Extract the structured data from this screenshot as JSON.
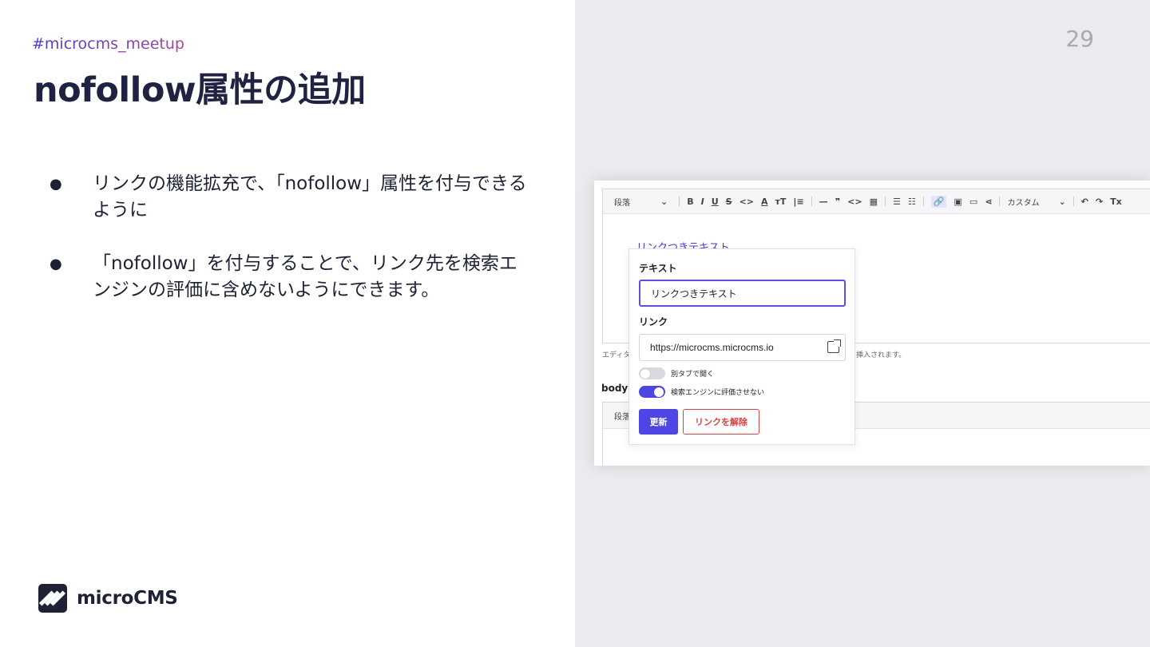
{
  "slide": {
    "hashtag": "#microcms_meetup",
    "title": "nofollow属性の追加",
    "page_number": "29",
    "bullets": [
      {
        "marker": "●",
        "text": "リンクの機能拡充で、「nofollow」属性を付与できるように"
      },
      {
        "marker": "●",
        "text": "「nofollow」を付与することで、リンク先を検索エンジンの評価に含めないようにできます。"
      }
    ],
    "logo_text": "microCMS"
  },
  "screenshot": {
    "toolbar": {
      "paragraph_select": "段落",
      "chevron": "⌄",
      "buttons": [
        "B",
        "I",
        "U",
        "S",
        "<>",
        "A",
        "ᴛT",
        "|≡",
        "—",
        "❞",
        "<>",
        "▦",
        "☰",
        "☷",
        "🔗",
        "▣",
        "▭",
        "⋖",
        "カスタム",
        "⌄",
        "↶",
        "↷",
        "Tx"
      ]
    },
    "link_text": "リンクつきテキスト",
    "hint_left": "エディタ",
    "hint_right": "挿入されます。",
    "body_label": "body:",
    "toolbar2_paragraph": "段落",
    "popup": {
      "text_label": "テキスト",
      "text_value": "リンクつきテキスト",
      "link_label": "リンク",
      "link_value": "https://microcms.microcms.io",
      "toggle_new_tab": {
        "label": "別タブで開く",
        "on": false
      },
      "toggle_nofollow": {
        "label": "検索エンジンに評価させない",
        "on": true
      },
      "update_button": "更新",
      "remove_button": "リンクを解除"
    },
    "colors": {
      "accent": "#4f45e4",
      "danger": "#d64545"
    }
  }
}
